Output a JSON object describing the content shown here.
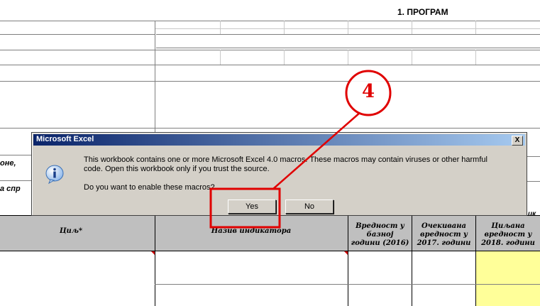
{
  "sheet": {
    "program_title": "1. ПРОГРАМ",
    "fragment_left_1": "оне,",
    "fragment_left_2": "а спр",
    "fragment_right": "ик",
    "table_headers": {
      "goal": "Циљ*",
      "indicator_name": "Назив индикатора",
      "base_value": [
        "Вредност у",
        "базној",
        "години (2016)"
      ],
      "expected_value": [
        "Очекивана",
        "вредност у",
        "2017. години"
      ],
      "target_value": [
        "Циљана",
        "вредност у",
        "2018. години"
      ]
    },
    "colors": {
      "header_fill": "#bfbfbf",
      "target_fill": "#ffff99",
      "comment_marker": "#d00000"
    }
  },
  "dialog": {
    "title": "Microsoft Excel",
    "close_label": "X",
    "icon": "info-icon",
    "message_line1": "This workbook contains one or more Microsoft Excel 4.0 macros. These macros may contain viruses or other harmful",
    "message_line2": "code. Open this workbook only if you trust the source.",
    "question": "Do you want to enable these macros?",
    "yes_label": "Yes",
    "no_label": "No"
  },
  "annotation": {
    "step_number": "4",
    "color": "#e00000"
  }
}
